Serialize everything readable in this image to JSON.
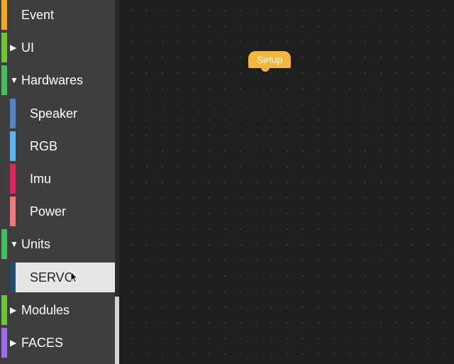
{
  "toolbox": {
    "categories": [
      {
        "label": "Event",
        "color": "#f5a623",
        "arrow": ""
      },
      {
        "label": "UI",
        "color": "#6bc72d",
        "arrow": "▶"
      },
      {
        "label": "Hardwares",
        "color": "#3fc15e",
        "arrow": "▼"
      },
      {
        "label": "Speaker",
        "color": "#4a86c8",
        "arrow": ""
      },
      {
        "label": "RGB",
        "color": "#5ab4f5",
        "arrow": ""
      },
      {
        "label": "Imu",
        "color": "#e2245c",
        "arrow": ""
      },
      {
        "label": "Power",
        "color": "#f07a7a",
        "arrow": ""
      },
      {
        "label": "Units",
        "color": "#3fc15e",
        "arrow": "▼"
      },
      {
        "label": "SERVO",
        "color": "#1c4f6b",
        "arrow": ""
      },
      {
        "label": "Modules",
        "color": "#6bc72d",
        "arrow": "▶"
      },
      {
        "label": "FACES",
        "color": "#9d6ef2",
        "arrow": "▶"
      }
    ]
  },
  "workspace": {
    "blocks": [
      {
        "label": "Setup",
        "color": "#f5b53a"
      }
    ]
  }
}
